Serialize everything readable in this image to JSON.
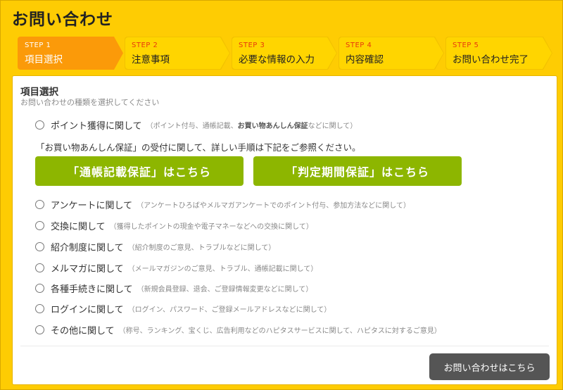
{
  "page": {
    "title": "お問い合わせ"
  },
  "steps": [
    {
      "num": "STEP 1",
      "label": "項目選択"
    },
    {
      "num": "STEP 2",
      "label": "注意事項"
    },
    {
      "num": "STEP 3",
      "label": "必要な情報の入力"
    },
    {
      "num": "STEP 4",
      "label": "内容確認"
    },
    {
      "num": "STEP 5",
      "label": "お問い合わせ完了"
    }
  ],
  "section": {
    "title": "項目選択",
    "subtitle": "お問い合わせの種類を選択してください"
  },
  "options": [
    {
      "label": "ポイント獲得に関して",
      "note_pre": "（ポイント付与、通帳記載、",
      "note_bold": "お買い物あんしん保証",
      "note_post": "などに関して）"
    },
    {
      "label": "アンケートに関して",
      "note": "（アンケートひろばやメルマガアンケートでのポイント付与、参加方法などに関して）"
    },
    {
      "label": "交換に関して",
      "note": "（獲得したポイントの現金や電子マネーなどへの交換に関して）"
    },
    {
      "label": "紹介制度に関して",
      "note": "（紹介制度のご意見、トラブルなどに関して）"
    },
    {
      "label": "メルマガに関して",
      "note": "（メールマガジンのご意見、トラブル、通帳記載に関して）"
    },
    {
      "label": "各種手続きに関して",
      "note": "（新規会員登録、退会、ご登録情報変更などに関して）"
    },
    {
      "label": "ログインに関して",
      "note": "（ログイン、パスワード、ご登録メールアドレスなどに関して）"
    },
    {
      "label": "その他に関して",
      "note": "（称号、ランキング、宝くじ、広告利用などのハピタスサービスに関して、ハピタスに対するご意見）"
    }
  ],
  "notice": "「お買い物あんしん保証」の受付に関して、詳しい手順は下記をご参照ください。",
  "buttons": {
    "passbook": "「通帳記載保証」はこちら",
    "period": "「判定期間保証」はこちら",
    "submit": "お問い合わせはこちら"
  },
  "colors": {
    "background": "#fecc03",
    "active_step": "#fb9a09",
    "step_number": "#e8380d",
    "green_button": "#8db600",
    "submit_button": "#555555"
  }
}
